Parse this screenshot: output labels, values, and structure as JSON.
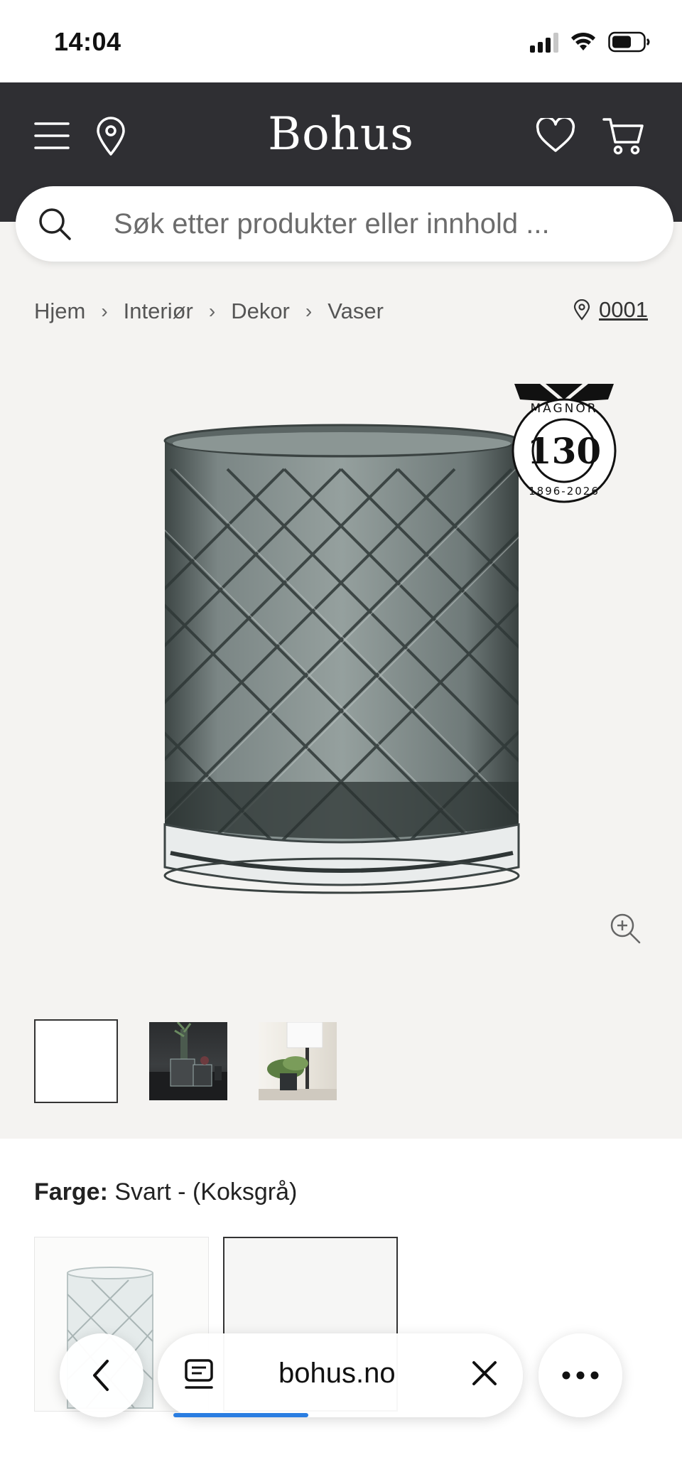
{
  "status_bar": {
    "time": "14:04"
  },
  "header": {
    "logo": "Bohus"
  },
  "search": {
    "placeholder": "Søk etter produkter eller innhold ..."
  },
  "breadcrumb": {
    "items": [
      {
        "label": "Hjem"
      },
      {
        "label": "Interiør"
      },
      {
        "label": "Dekor"
      },
      {
        "label": "Vaser"
      }
    ]
  },
  "store": {
    "label": "0001"
  },
  "badge": {
    "brand": "MAGNOR",
    "number": "130",
    "years": "1896-2026"
  },
  "product": {
    "color_label": "Farge:",
    "color_value": "Svart - (Koksgrå)"
  },
  "browser": {
    "url": "bohus.no"
  },
  "colors": {
    "header_bg": "#2f2f33",
    "page_bg": "#f4f3f1",
    "accent_progress": "#2a7de1"
  }
}
